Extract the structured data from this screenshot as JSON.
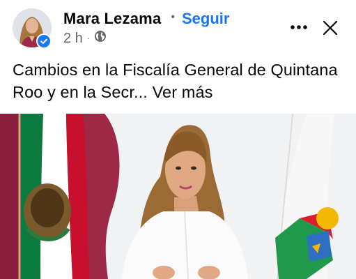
{
  "post": {
    "author": {
      "name": "Mara Lezama",
      "verified": true
    },
    "follow_label": "Seguir",
    "separator": "•",
    "time": "2 h",
    "meta_separator": "·",
    "privacy_icon": "globe-icon",
    "text": "Cambios en la Fiscalía General de Quintana Roo y en la Secr...",
    "see_more_label": "Ver más"
  },
  "actions": {
    "more_icon": "more-horizontal-icon",
    "close_icon": "close-icon"
  },
  "colors": {
    "accent": "#1877f2",
    "text_primary": "#050505",
    "text_secondary": "#65676b"
  }
}
